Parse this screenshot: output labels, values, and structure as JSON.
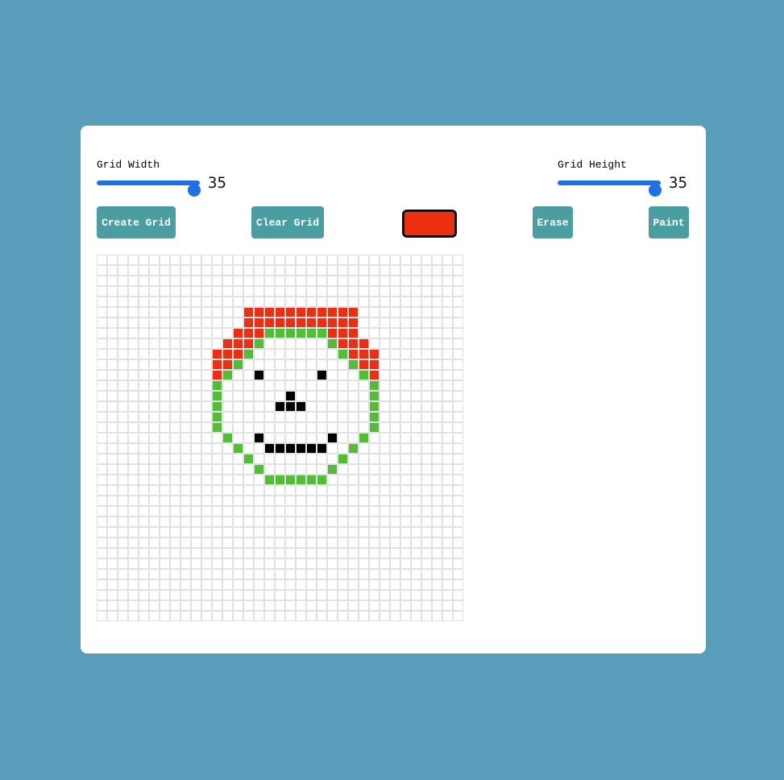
{
  "controls": {
    "width_label": "Grid Width",
    "width_value": "35",
    "height_label": "Grid Height",
    "height_value": "35"
  },
  "buttons": {
    "create": "Create Grid",
    "clear": "Clear Grid",
    "erase": "Erase",
    "paint": "Paint"
  },
  "colors": {
    "page_background": "#589dba",
    "button_bg": "#4a9ea2",
    "slider": "#1f6fe5",
    "selected_color": "#ee2e10",
    "red": "#ee2e10",
    "green": "#52bd36",
    "black": "#000000",
    "cell_border": "#e1e1e1"
  },
  "grid": {
    "cols": 35,
    "rows": 35,
    "painted": [
      {
        "row": 5,
        "col": 14,
        "color": "red"
      },
      {
        "row": 5,
        "col": 15,
        "color": "red"
      },
      {
        "row": 5,
        "col": 16,
        "color": "red"
      },
      {
        "row": 5,
        "col": 17,
        "color": "red"
      },
      {
        "row": 5,
        "col": 18,
        "color": "red"
      },
      {
        "row": 5,
        "col": 19,
        "color": "red"
      },
      {
        "row": 5,
        "col": 20,
        "color": "red"
      },
      {
        "row": 5,
        "col": 21,
        "color": "red"
      },
      {
        "row": 5,
        "col": 22,
        "color": "red"
      },
      {
        "row": 5,
        "col": 23,
        "color": "red"
      },
      {
        "row": 5,
        "col": 24,
        "color": "red"
      },
      {
        "row": 6,
        "col": 14,
        "color": "red"
      },
      {
        "row": 6,
        "col": 15,
        "color": "red"
      },
      {
        "row": 6,
        "col": 16,
        "color": "red"
      },
      {
        "row": 6,
        "col": 17,
        "color": "red"
      },
      {
        "row": 6,
        "col": 18,
        "color": "red"
      },
      {
        "row": 6,
        "col": 19,
        "color": "red"
      },
      {
        "row": 6,
        "col": 20,
        "color": "red"
      },
      {
        "row": 6,
        "col": 21,
        "color": "red"
      },
      {
        "row": 6,
        "col": 22,
        "color": "red"
      },
      {
        "row": 6,
        "col": 23,
        "color": "red"
      },
      {
        "row": 6,
        "col": 24,
        "color": "red"
      },
      {
        "row": 7,
        "col": 13,
        "color": "red"
      },
      {
        "row": 7,
        "col": 14,
        "color": "red"
      },
      {
        "row": 7,
        "col": 15,
        "color": "red"
      },
      {
        "row": 7,
        "col": 16,
        "color": "green"
      },
      {
        "row": 7,
        "col": 17,
        "color": "green"
      },
      {
        "row": 7,
        "col": 18,
        "color": "green"
      },
      {
        "row": 7,
        "col": 19,
        "color": "green"
      },
      {
        "row": 7,
        "col": 20,
        "color": "green"
      },
      {
        "row": 7,
        "col": 21,
        "color": "green"
      },
      {
        "row": 7,
        "col": 22,
        "color": "red"
      },
      {
        "row": 7,
        "col": 23,
        "color": "red"
      },
      {
        "row": 7,
        "col": 24,
        "color": "red"
      },
      {
        "row": 8,
        "col": 12,
        "color": "red"
      },
      {
        "row": 8,
        "col": 13,
        "color": "red"
      },
      {
        "row": 8,
        "col": 14,
        "color": "red"
      },
      {
        "row": 8,
        "col": 15,
        "color": "green"
      },
      {
        "row": 8,
        "col": 22,
        "color": "green"
      },
      {
        "row": 8,
        "col": 23,
        "color": "red"
      },
      {
        "row": 8,
        "col": 24,
        "color": "red"
      },
      {
        "row": 8,
        "col": 25,
        "color": "red"
      },
      {
        "row": 9,
        "col": 11,
        "color": "red"
      },
      {
        "row": 9,
        "col": 12,
        "color": "red"
      },
      {
        "row": 9,
        "col": 13,
        "color": "red"
      },
      {
        "row": 9,
        "col": 14,
        "color": "green"
      },
      {
        "row": 9,
        "col": 23,
        "color": "green"
      },
      {
        "row": 9,
        "col": 24,
        "color": "red"
      },
      {
        "row": 9,
        "col": 25,
        "color": "red"
      },
      {
        "row": 9,
        "col": 26,
        "color": "red"
      },
      {
        "row": 10,
        "col": 11,
        "color": "red"
      },
      {
        "row": 10,
        "col": 12,
        "color": "red"
      },
      {
        "row": 10,
        "col": 13,
        "color": "green"
      },
      {
        "row": 10,
        "col": 24,
        "color": "green"
      },
      {
        "row": 10,
        "col": 25,
        "color": "red"
      },
      {
        "row": 10,
        "col": 26,
        "color": "red"
      },
      {
        "row": 11,
        "col": 11,
        "color": "red"
      },
      {
        "row": 11,
        "col": 12,
        "color": "green"
      },
      {
        "row": 11,
        "col": 15,
        "color": "black"
      },
      {
        "row": 11,
        "col": 21,
        "color": "black"
      },
      {
        "row": 11,
        "col": 25,
        "color": "green"
      },
      {
        "row": 11,
        "col": 26,
        "color": "red"
      },
      {
        "row": 12,
        "col": 11,
        "color": "green"
      },
      {
        "row": 12,
        "col": 26,
        "color": "green"
      },
      {
        "row": 13,
        "col": 11,
        "color": "green"
      },
      {
        "row": 13,
        "col": 18,
        "color": "black"
      },
      {
        "row": 13,
        "col": 26,
        "color": "green"
      },
      {
        "row": 14,
        "col": 11,
        "color": "green"
      },
      {
        "row": 14,
        "col": 17,
        "color": "black"
      },
      {
        "row": 14,
        "col": 18,
        "color": "black"
      },
      {
        "row": 14,
        "col": 19,
        "color": "black"
      },
      {
        "row": 14,
        "col": 26,
        "color": "green"
      },
      {
        "row": 15,
        "col": 11,
        "color": "green"
      },
      {
        "row": 15,
        "col": 26,
        "color": "green"
      },
      {
        "row": 16,
        "col": 11,
        "color": "green"
      },
      {
        "row": 16,
        "col": 26,
        "color": "green"
      },
      {
        "row": 17,
        "col": 12,
        "color": "green"
      },
      {
        "row": 17,
        "col": 15,
        "color": "black"
      },
      {
        "row": 17,
        "col": 22,
        "color": "black"
      },
      {
        "row": 17,
        "col": 25,
        "color": "green"
      },
      {
        "row": 18,
        "col": 13,
        "color": "green"
      },
      {
        "row": 18,
        "col": 16,
        "color": "black"
      },
      {
        "row": 18,
        "col": 17,
        "color": "black"
      },
      {
        "row": 18,
        "col": 18,
        "color": "black"
      },
      {
        "row": 18,
        "col": 19,
        "color": "black"
      },
      {
        "row": 18,
        "col": 20,
        "color": "black"
      },
      {
        "row": 18,
        "col": 21,
        "color": "black"
      },
      {
        "row": 18,
        "col": 24,
        "color": "green"
      },
      {
        "row": 19,
        "col": 14,
        "color": "green"
      },
      {
        "row": 19,
        "col": 23,
        "color": "green"
      },
      {
        "row": 20,
        "col": 15,
        "color": "green"
      },
      {
        "row": 20,
        "col": 22,
        "color": "green"
      },
      {
        "row": 21,
        "col": 16,
        "color": "green"
      },
      {
        "row": 21,
        "col": 17,
        "color": "green"
      },
      {
        "row": 21,
        "col": 18,
        "color": "green"
      },
      {
        "row": 21,
        "col": 19,
        "color": "green"
      },
      {
        "row": 21,
        "col": 20,
        "color": "green"
      },
      {
        "row": 21,
        "col": 21,
        "color": "green"
      }
    ]
  }
}
